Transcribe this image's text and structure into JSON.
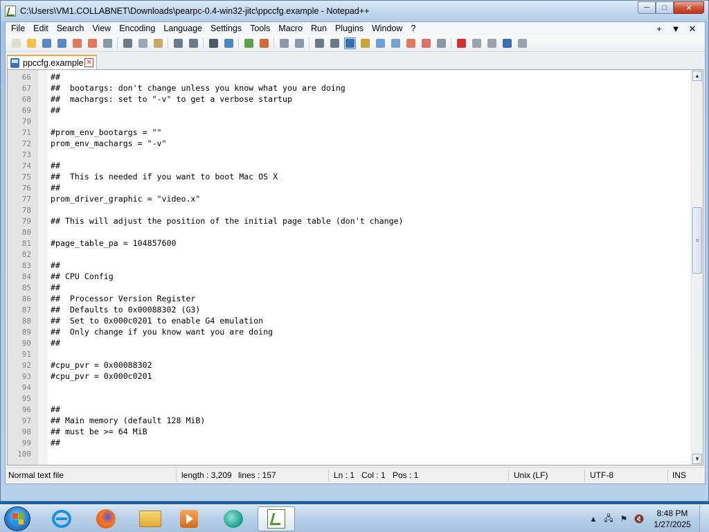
{
  "window": {
    "title": "C:\\Users\\VM1.COLLABNET\\Downloads\\pearpc-0.4-win32-jitc\\ppccfg.example - Notepad++",
    "controls": {
      "minimize": "─",
      "maximize": "□",
      "close": "✕"
    }
  },
  "menubar": {
    "items": [
      "File",
      "Edit",
      "Search",
      "View",
      "Encoding",
      "Language",
      "Settings",
      "Tools",
      "Macro",
      "Run",
      "Plugins",
      "Window",
      "?"
    ],
    "right": [
      "+",
      "▼",
      "✕"
    ]
  },
  "toolbar": {
    "icons": [
      {
        "name": "new-file-icon",
        "color": "#d8e4c8"
      },
      {
        "name": "open-file-icon",
        "color": "#f2c14e"
      },
      {
        "name": "save-icon",
        "color": "#5b87c5"
      },
      {
        "name": "save-all-icon",
        "color": "#5b87c5"
      },
      {
        "name": "close-file-icon",
        "color": "#e07a5f"
      },
      {
        "name": "close-all-icon",
        "color": "#e07a5f"
      },
      {
        "name": "print-icon",
        "color": "#8a97a6"
      },
      {
        "name": "sep"
      },
      {
        "name": "cut-icon",
        "color": "#6c7a89"
      },
      {
        "name": "copy-icon",
        "color": "#9aa7b4"
      },
      {
        "name": "paste-icon",
        "color": "#c9a56a"
      },
      {
        "name": "sep"
      },
      {
        "name": "undo-icon",
        "color": "#6d7c8b"
      },
      {
        "name": "redo-icon",
        "color": "#6d7c8b"
      },
      {
        "name": "sep"
      },
      {
        "name": "find-icon",
        "color": "#4b5a68"
      },
      {
        "name": "replace-icon",
        "color": "#4a86c5"
      },
      {
        "name": "sep"
      },
      {
        "name": "zoom-in-icon",
        "color": "#5aa14a"
      },
      {
        "name": "zoom-out-icon",
        "color": "#d06a3a"
      },
      {
        "name": "sep"
      },
      {
        "name": "sync-vertical-icon",
        "color": "#8c9aa8"
      },
      {
        "name": "sync-horizontal-icon",
        "color": "#8c9aa8"
      },
      {
        "name": "sep"
      },
      {
        "name": "word-wrap-icon",
        "color": "#6a7a8a"
      },
      {
        "name": "show-all-chars-icon",
        "color": "#6a7a8a"
      },
      {
        "name": "indent-guide-icon",
        "color": "#3a6fb0",
        "active": true
      },
      {
        "name": "user-language-icon",
        "color": "#c9a23a"
      },
      {
        "name": "doc-map-icon",
        "color": "#6ea0d8"
      },
      {
        "name": "function-list-icon",
        "color": "#7aa3cf"
      },
      {
        "name": "folder-workspace-icon",
        "color": "#e07a5f"
      },
      {
        "name": "doc-switcher-icon",
        "color": "#d8736a"
      },
      {
        "name": "monitoring-icon",
        "color": "#8a97a6"
      },
      {
        "name": "sep"
      },
      {
        "name": "record-macro-icon",
        "color": "#d03030"
      },
      {
        "name": "stop-macro-icon",
        "color": "#9aa4ae"
      },
      {
        "name": "play-macro-icon",
        "color": "#9aa4ae"
      },
      {
        "name": "run-macro-multiple-icon",
        "color": "#3a6fb0"
      },
      {
        "name": "save-macro-icon",
        "color": "#9aa4ae"
      }
    ]
  },
  "tab": {
    "label": "ppccfg.example",
    "close": "✕"
  },
  "editor": {
    "lines": [
      {
        "n": "66",
        "text": "##"
      },
      {
        "n": "67",
        "text": "##  bootargs: don't change unless you know what you are doing"
      },
      {
        "n": "68",
        "text": "##  machargs: set to \"-v\" to get a verbose startup"
      },
      {
        "n": "69",
        "text": "##"
      },
      {
        "n": "70",
        "text": ""
      },
      {
        "n": "71",
        "text": "#prom_env_bootargs = \"\""
      },
      {
        "n": "72",
        "text": "prom_env_machargs = \"-v\""
      },
      {
        "n": "73",
        "text": ""
      },
      {
        "n": "74",
        "text": "##"
      },
      {
        "n": "75",
        "text": "##  This is needed if you want to boot Mac OS X"
      },
      {
        "n": "76",
        "text": "##"
      },
      {
        "n": "77",
        "text": "prom_driver_graphic = \"video.x\""
      },
      {
        "n": "78",
        "text": ""
      },
      {
        "n": "79",
        "text": "## This will adjust the position of the initial page table (don't change)"
      },
      {
        "n": "80",
        "text": ""
      },
      {
        "n": "81",
        "text": "#page_table_pa = 104857600"
      },
      {
        "n": "82",
        "text": ""
      },
      {
        "n": "83",
        "text": "##"
      },
      {
        "n": "84",
        "text": "## CPU Config"
      },
      {
        "n": "85",
        "text": "##"
      },
      {
        "n": "86",
        "text": "##  Processor Version Register"
      },
      {
        "n": "87",
        "text": "##  Defaults to 0x00088302 (G3)"
      },
      {
        "n": "88",
        "text": "##  Set to 0x000c0201 to enable G4 emulation"
      },
      {
        "n": "89",
        "text": "##  Only change if you know want you are doing"
      },
      {
        "n": "90",
        "text": "##"
      },
      {
        "n": "91",
        "text": ""
      },
      {
        "n": "92",
        "text": "#cpu_pvr = 0x00088302"
      },
      {
        "n": "93",
        "text": "#cpu_pvr = 0x000c0201"
      },
      {
        "n": "94",
        "text": ""
      },
      {
        "n": "95",
        "text": ""
      },
      {
        "n": "96",
        "text": "##"
      },
      {
        "n": "97",
        "text": "## Main memory (default 128 MiB)"
      },
      {
        "n": "98",
        "text": "## must be >= 64 MiB"
      },
      {
        "n": "99",
        "text": "##"
      },
      {
        "n": "100",
        "text": ""
      }
    ],
    "scroll": {
      "up": "▲",
      "down": "▼",
      "thumb": "≡"
    }
  },
  "statusbar": {
    "file_type": "Normal text file",
    "length": "length : 3,209",
    "lines": "lines : 157",
    "ln": "Ln : 1",
    "col": "Col : 1",
    "pos": "Pos : 1",
    "eol": "Unix (LF)",
    "encoding": "UTF-8",
    "mode": "INS"
  },
  "taskbar": {
    "apps": [
      {
        "name": "internet-explorer-icon"
      },
      {
        "name": "firefox-icon"
      },
      {
        "name": "file-explorer-icon"
      },
      {
        "name": "media-player-icon"
      },
      {
        "name": "chat-app-icon"
      },
      {
        "name": "notepad-plus-plus-icon",
        "active": true
      }
    ],
    "tray": {
      "show_hidden": "▲",
      "network": "🖧",
      "flag": "⚑",
      "volume": "🔇",
      "time": "8:48 PM",
      "date": "1/27/2025"
    }
  }
}
